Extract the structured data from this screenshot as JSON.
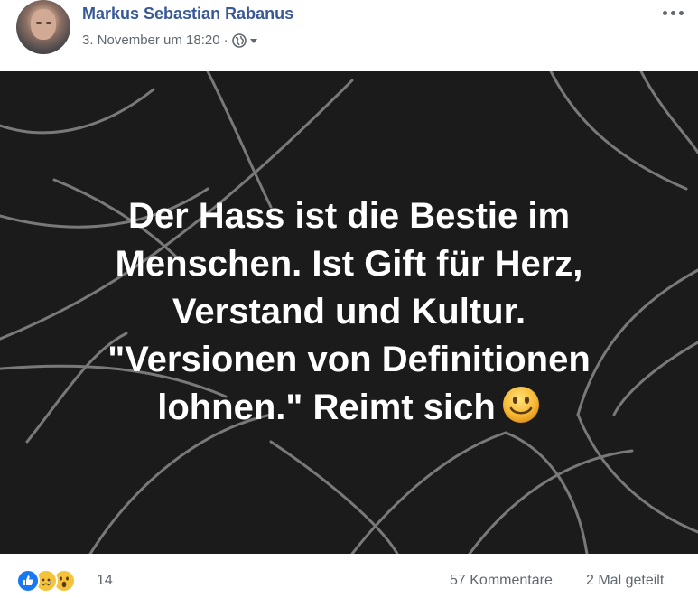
{
  "post": {
    "author": "Markus Sebastian Rabanus",
    "timestamp": "3. November um 18:20",
    "separator": "·",
    "privacy_icon": "globe-icon",
    "more_icon": "more-options-icon"
  },
  "image": {
    "quote_lines": [
      "Der Hass ist die Bestie im",
      "Menschen. Ist Gift für Herz,",
      "Verstand und Kultur.",
      "\"Versionen von Definitionen",
      "lohnen.\" Reimt sich"
    ],
    "emoji": "smiling-face-icon",
    "background_color": "#1b1b1b",
    "text_color": "#ffffff"
  },
  "footer": {
    "reaction_icons": [
      "like-icon",
      "sad-icon",
      "wow-icon"
    ],
    "reaction_count": "14",
    "comments": "57 Kommentare",
    "shares": "2 Mal geteilt"
  },
  "colors": {
    "author_link": "#385898",
    "meta_text": "#616770",
    "like_blue": "#1877f2",
    "reaction_yellow": "#f5c33b"
  }
}
